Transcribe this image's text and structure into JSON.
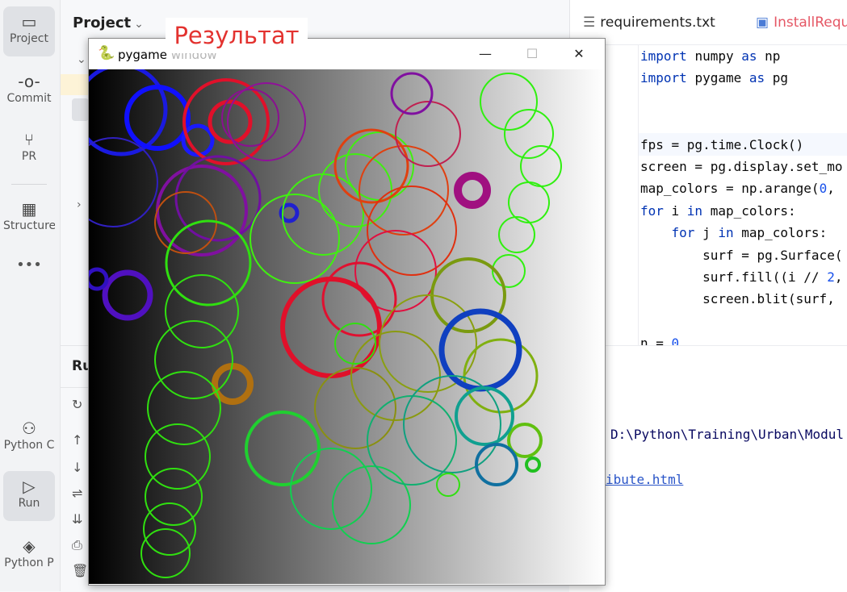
{
  "sidebar": {
    "items": [
      {
        "label": "Project",
        "icon": "folder-icon",
        "glyph": "🗀"
      },
      {
        "label": "Commit",
        "icon": "commit-icon",
        "glyph": "-o-"
      },
      {
        "label": "PR",
        "icon": "pull-request-icon",
        "glyph": "⑂"
      },
      {
        "label": "Structure",
        "icon": "structure-icon",
        "glyph": "▦"
      },
      {
        "label": "•••",
        "icon": "more-icon",
        "glyph": ""
      },
      {
        "label": "Python C",
        "icon": "python-console-icon",
        "glyph": "⚇"
      },
      {
        "label": "Run",
        "icon": "run-icon",
        "glyph": "▷"
      },
      {
        "label": "Python P",
        "icon": "python-packages-icon",
        "glyph": "◈"
      }
    ]
  },
  "project": {
    "title": "Project",
    "chevron": "⌄"
  },
  "run": {
    "title": "Ru"
  },
  "editor": {
    "tabs": [
      "requirements.txt",
      "InstallRequ"
    ],
    "lines": [
      [
        {
          "t": "import ",
          "k": "kw"
        },
        {
          "t": "numpy "
        },
        {
          "t": "as ",
          "k": "kw"
        },
        {
          "t": "np"
        }
      ],
      [
        {
          "t": "import ",
          "k": "kw"
        },
        {
          "t": "pygame "
        },
        {
          "t": "as ",
          "k": "kw"
        },
        {
          "t": "pg"
        }
      ],
      [],
      [],
      [
        {
          "t": "fps = pg.time.Clock()"
        }
      ],
      [
        {
          "t": "screen = pg.display.set_mo"
        }
      ],
      [
        {
          "t": "map_colors = np.arange("
        },
        {
          "t": "0",
          "k": "num"
        },
        {
          "t": ","
        }
      ],
      [
        {
          "t": "for ",
          "k": "kw"
        },
        {
          "t": "i "
        },
        {
          "t": "in ",
          "k": "kw"
        },
        {
          "t": "map_colors:"
        }
      ],
      [
        {
          "t": "    "
        },
        {
          "t": "for ",
          "k": "kw"
        },
        {
          "t": "j "
        },
        {
          "t": "in ",
          "k": "kw"
        },
        {
          "t": "map_colors:"
        }
      ],
      [
        {
          "t": "        surf = pg.Surface("
        }
      ],
      [
        {
          "t": "        surf.fill((i // "
        },
        {
          "t": "2",
          "k": "num"
        },
        {
          "t": ","
        }
      ],
      [
        {
          "t": "        screen.blit(surf,"
        }
      ],
      [],
      [
        {
          "t": "n = "
        },
        {
          "t": "0",
          "k": "num"
        }
      ]
    ]
  },
  "console": {
    "path": "D:\\Python\\Training\\Urban\\Modul",
    "link": "ibute.html"
  },
  "pygame": {
    "title": "pygame window",
    "minimize": "—",
    "maximize": "☐",
    "close": "✕"
  },
  "overlay_label": "Результат"
}
